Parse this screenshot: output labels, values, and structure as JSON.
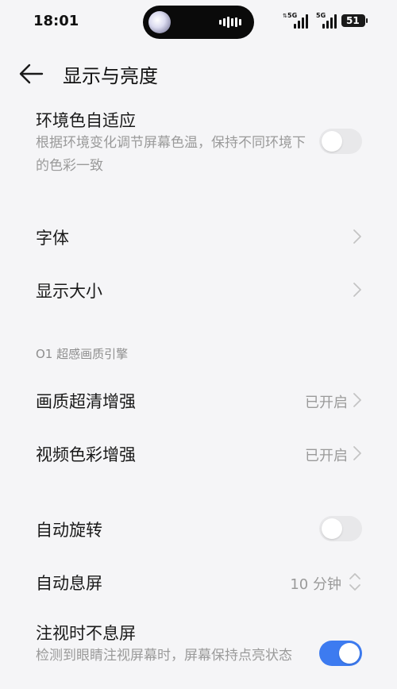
{
  "status_bar": {
    "time": "18:01",
    "sim1_network": "5G",
    "sim2_network": "5G",
    "battery_level": "51"
  },
  "header": {
    "title": "显示与亮度"
  },
  "settings": {
    "ambient_color": {
      "title": "环境色自适应",
      "description": "根据环境变化调节屏幕色温，保持不同环境下的色彩一致",
      "enabled": false
    },
    "font": {
      "title": "字体"
    },
    "display_size": {
      "title": "显示大小"
    },
    "section_o1": {
      "label": "O1 超感画质引擎"
    },
    "image_enhance": {
      "title": "画质超清增强",
      "value": "已开启"
    },
    "video_color": {
      "title": "视频色彩增强",
      "value": "已开启"
    },
    "auto_rotate": {
      "title": "自动旋转",
      "enabled": false
    },
    "auto_sleep": {
      "title": "自动息屏",
      "value": "10 分钟"
    },
    "gaze_awake": {
      "title": "注视时不息屏",
      "description": "检测到眼睛注视屏幕时，屏幕保持点亮状态",
      "enabled": true
    }
  },
  "colors": {
    "background": "#f5f5f7",
    "toggle_on": "#3d7bf0",
    "toggle_off": "#e8e8ea",
    "secondary_text": "#9a9a9a"
  }
}
